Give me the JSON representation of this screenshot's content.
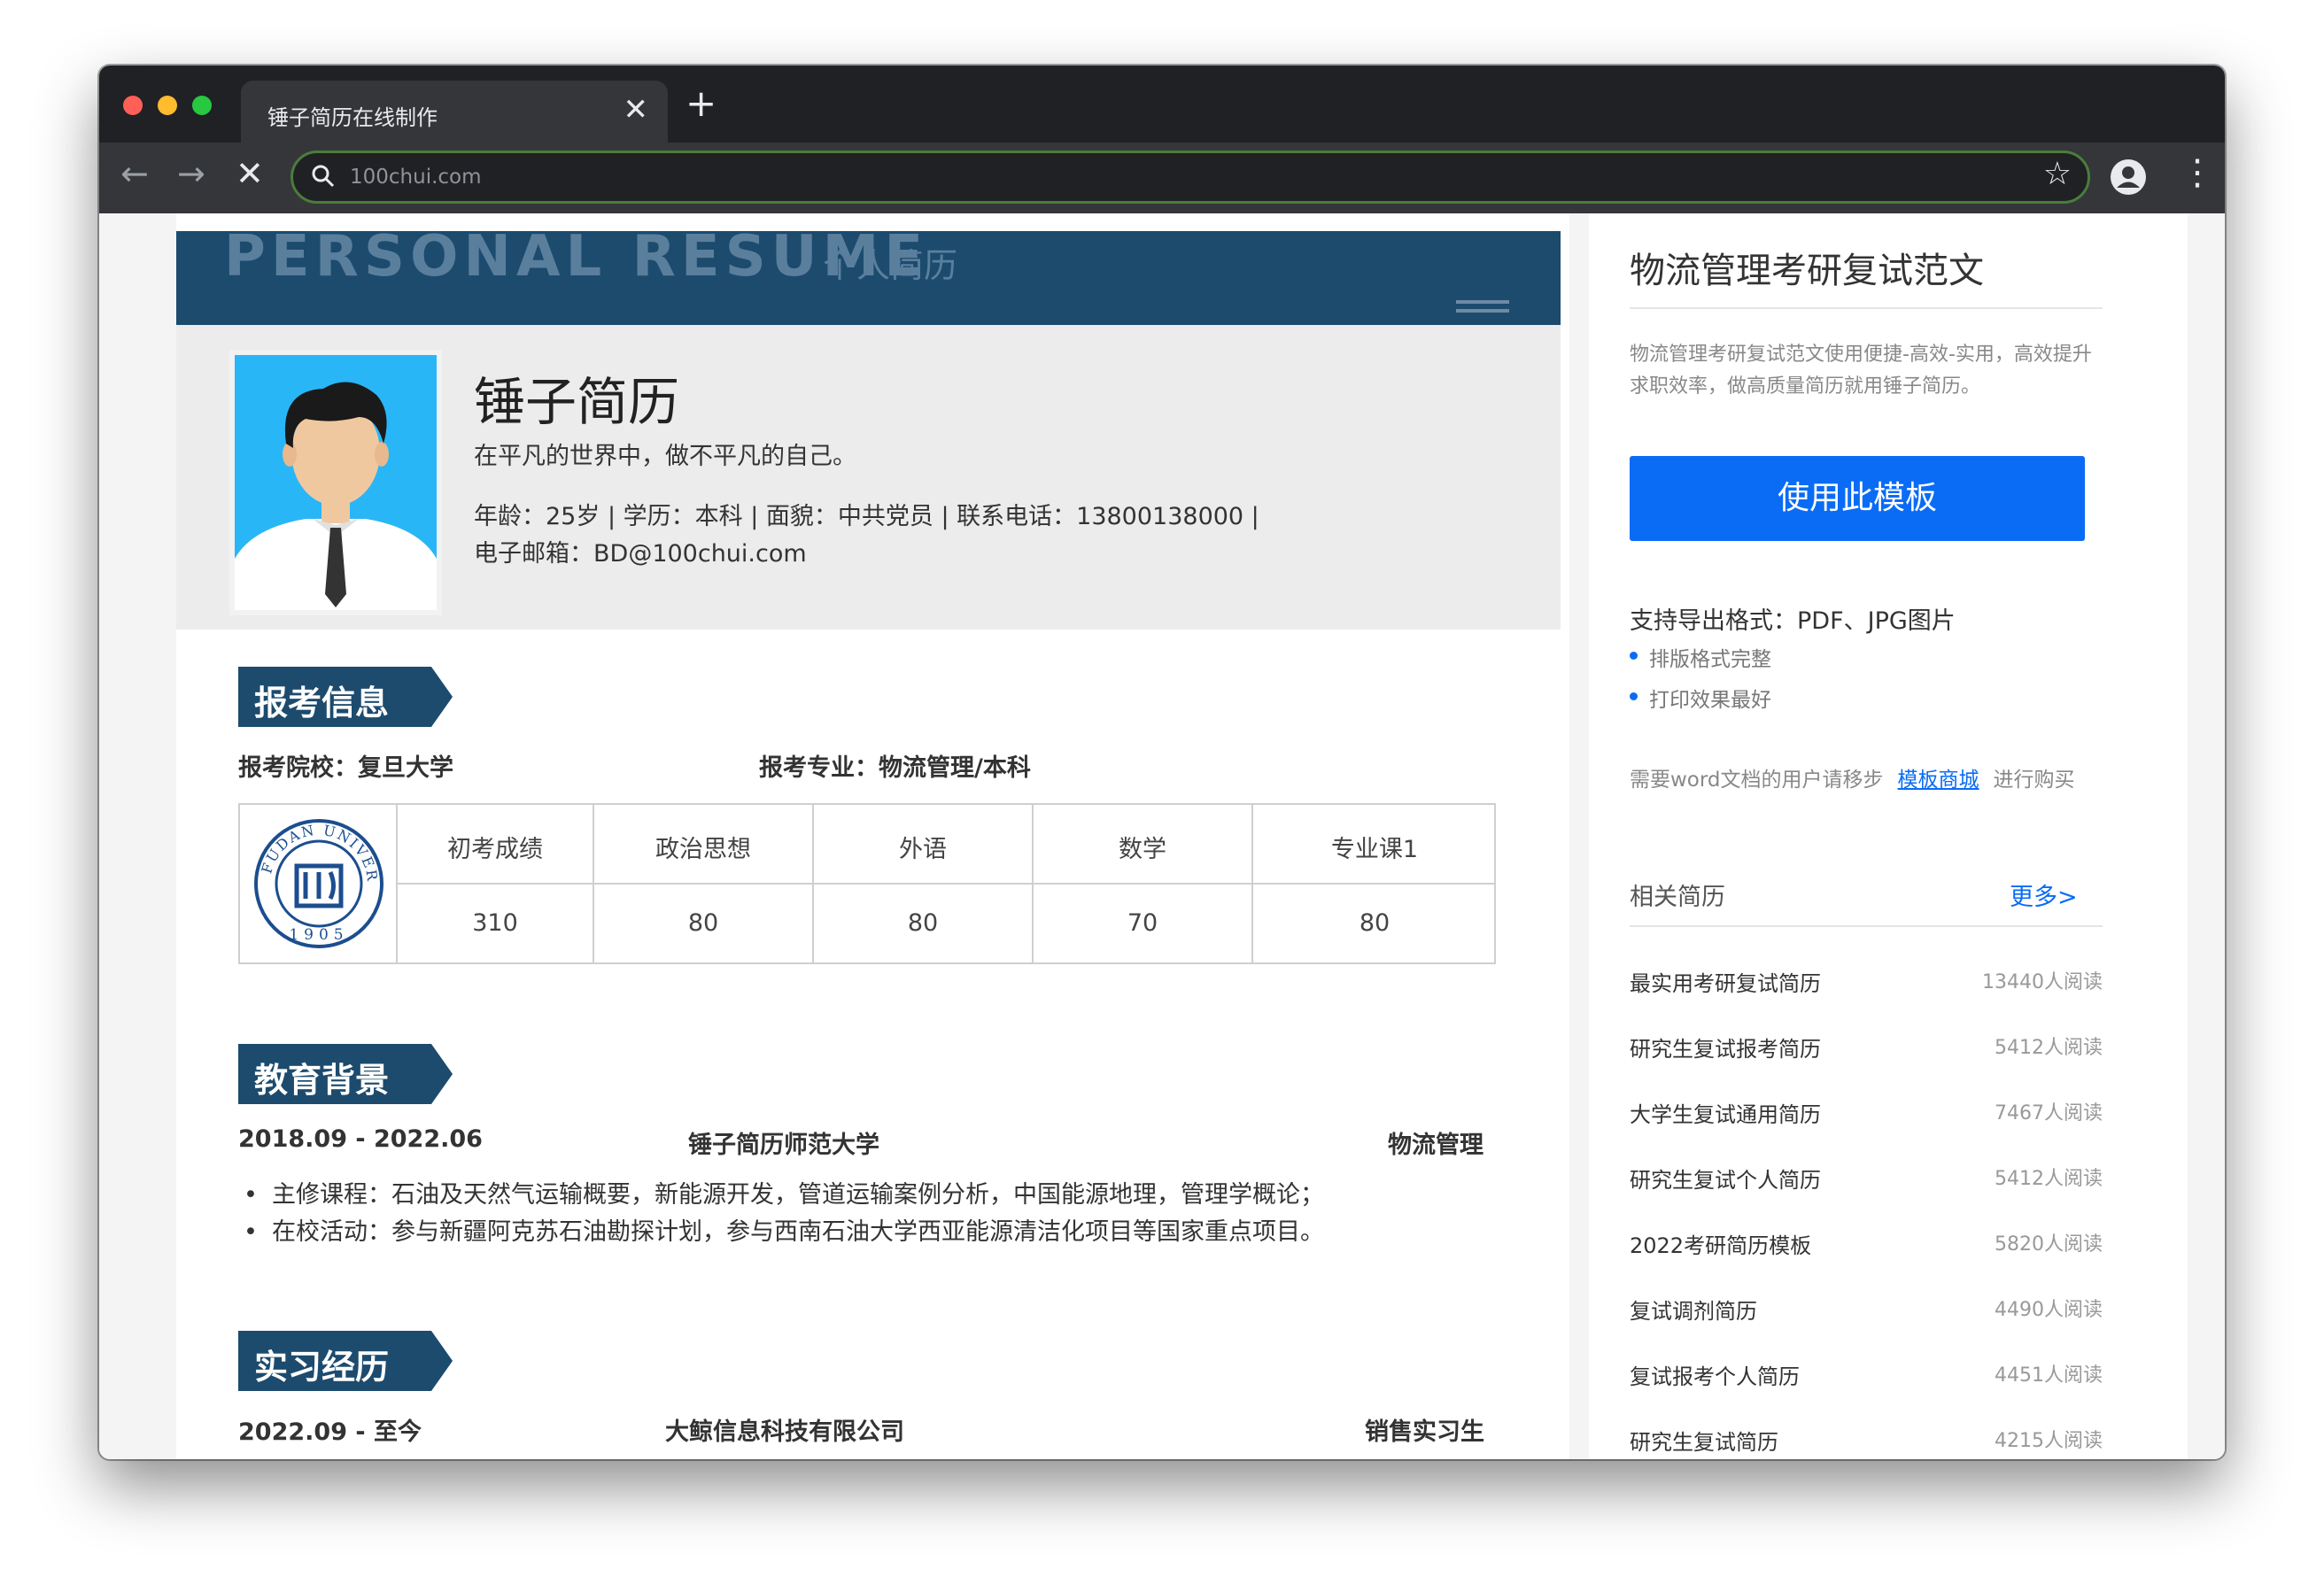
{
  "browser": {
    "tab_title": "锤子简历在线制作",
    "tab_close": "✕",
    "new_tab": "+",
    "url": "100chui.com",
    "back": "←",
    "forward": "→",
    "stop": "✕",
    "star": "☆",
    "menu": "⋮"
  },
  "resume": {
    "title_en": "PERSONAL RESUME",
    "title_cn": "个人简历",
    "name": "锤子简历",
    "motto": "在平凡的世界中，做不平凡的自己。",
    "info_line1": "年龄：25岁 | 学历：本科 | 面貌：中共党员 | 联系电话：13800138000 |",
    "info_line2": "电子邮箱：BD@100chui.com",
    "section_apply": "报考信息",
    "apply_school": "报考院校：复旦大学",
    "apply_major": "报考专业：物流管理/本科",
    "score_headers": [
      "初考成绩",
      "政治思想",
      "外语",
      "数学",
      "专业课1"
    ],
    "score_values": [
      "310",
      "80",
      "80",
      "70",
      "80"
    ],
    "logo_text_top": "FUDAN UNIVERSITY",
    "logo_year": "1905",
    "section_edu": "教育背景",
    "edu_period": "2018.09 - 2022.06",
    "edu_school": "锤子简历师范大学",
    "edu_major": "物流管理",
    "edu_bullets": [
      "主修课程：石油及天然气运输概要，新能源开发，管道运输案例分析，中国能源地理，管理学概论；",
      "在校活动：参与新疆阿克苏石油勘探计划，参与西南石油大学西亚能源清洁化项目等国家重点项目。"
    ],
    "section_intern": "实习经历",
    "intern_period": "2022.09 - 至今",
    "intern_company": "大鲸信息科技有限公司",
    "intern_role": "销售实习生"
  },
  "sidebar": {
    "title": "物流管理考研复试范文",
    "desc": "物流管理考研复试范文使用便捷-高效-实用，高效提升求职效率，做高质量简历就用锤子简历。",
    "use_button": "使用此模板",
    "formats": "支持导出格式：PDF、JPG图片",
    "features": [
      "排版格式完整",
      "打印效果最好"
    ],
    "word_prefix": "需要word文档的用户请移步",
    "word_link": "模板商城",
    "word_suffix": "进行购买",
    "related_title": "相关简历",
    "more": "更多>",
    "related": [
      {
        "name": "最实用考研复试简历",
        "reads": "13440人阅读"
      },
      {
        "name": "研究生复试报考简历",
        "reads": "5412人阅读"
      },
      {
        "name": "大学生复试通用简历",
        "reads": "7467人阅读"
      },
      {
        "name": "研究生复试个人简历",
        "reads": "5412人阅读"
      },
      {
        "name": "2022考研简历模板",
        "reads": "5820人阅读"
      },
      {
        "name": "复试调剂简历",
        "reads": "4490人阅读"
      },
      {
        "name": "复试报考个人简历",
        "reads": "4451人阅读"
      },
      {
        "name": "研究生复试简历",
        "reads": "4215人阅读"
      }
    ]
  },
  "colors": {
    "header_blue": "#1c4b6e",
    "button_blue": "#0a6cf5",
    "photo_bg": "#29b6f6"
  }
}
